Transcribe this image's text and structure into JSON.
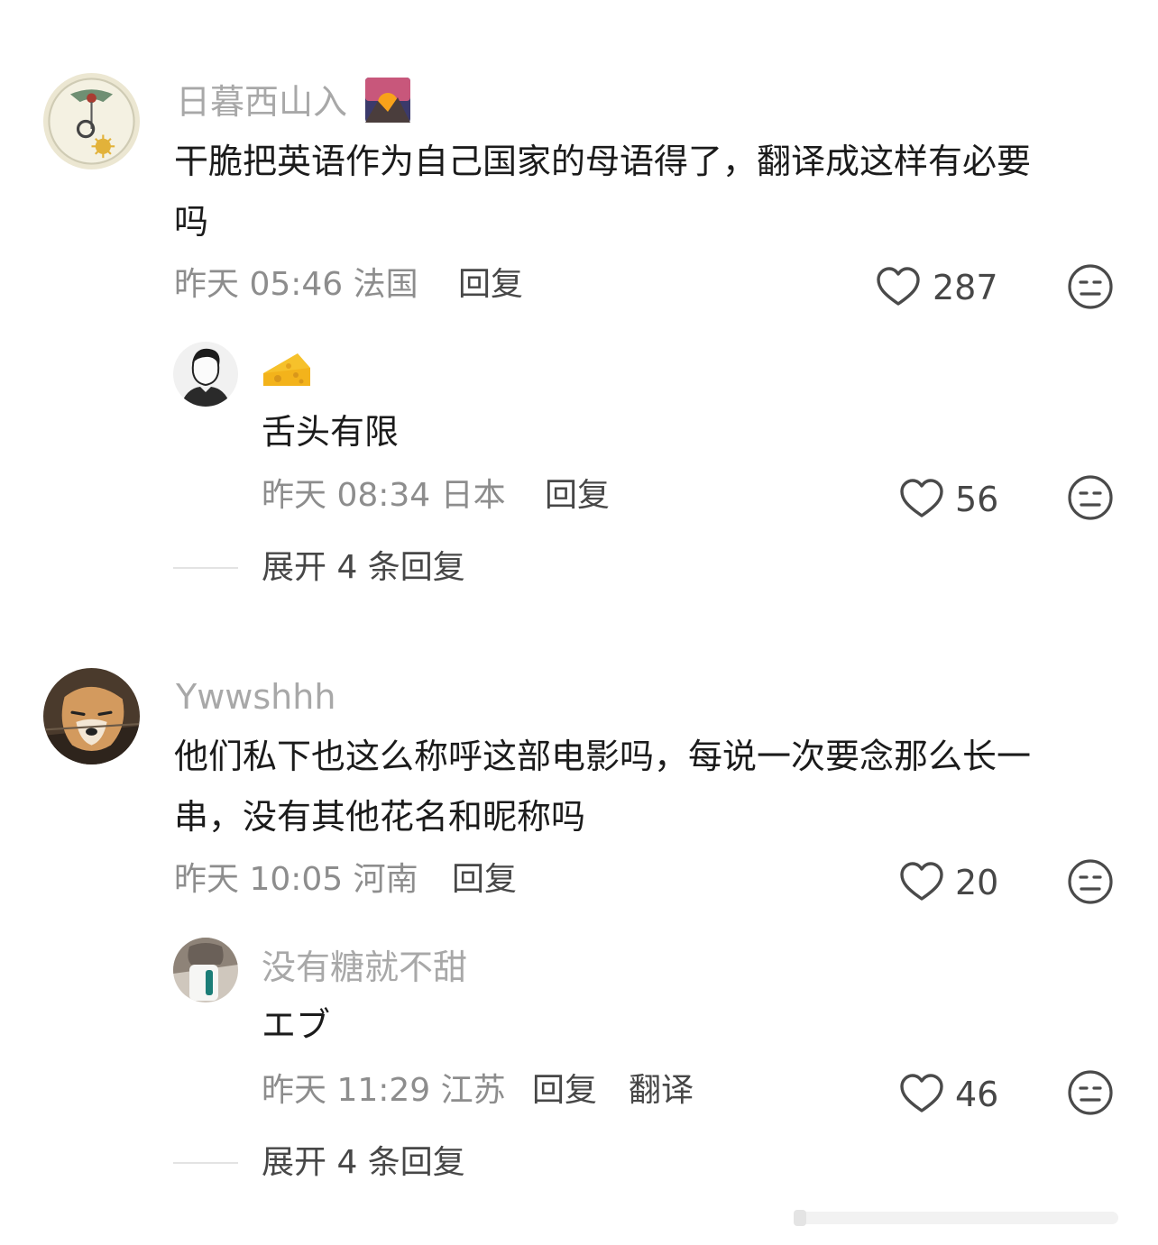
{
  "comments": [
    {
      "user": "日暮西山入",
      "text_line1": "干脆把英语作为自己国家的母语得了，翻译成这样有必要",
      "text_line2": "吗",
      "time": "昨天 05:46 法国",
      "reply_label": "回复",
      "likes": "287",
      "reply": {
        "user": "",
        "text": "舌头有限",
        "time": "昨天 08:34 日本",
        "reply_label": "回复",
        "likes": "56"
      },
      "expand_label": "展开 4 条回复"
    },
    {
      "user": "Ywwshhh",
      "text_line1": "他们私下也这么称呼这部电影吗，每说一次要念那么长一",
      "text_line2": "串，没有其他花名和昵称吗",
      "time": "昨天 10:05 河南",
      "reply_label": "回复",
      "likes": "20",
      "reply": {
        "user": "没有糖就不甜",
        "text": "エブ",
        "time": "昨天 11:29 江苏",
        "reply_label": "回复",
        "translate_label": "翻译",
        "likes": "46"
      },
      "expand_label": "展开 4 条回复"
    }
  ],
  "icons": {
    "like": "heart-outline-icon",
    "dislike": "meh-face-icon",
    "cheese": "cheese-emoji",
    "sunset": "mountain-sunset-emoji"
  },
  "colors": {
    "name": "#a8a8a8",
    "meta": "#8d8d8d",
    "action": "#474747",
    "text": "#1b1b1b"
  }
}
